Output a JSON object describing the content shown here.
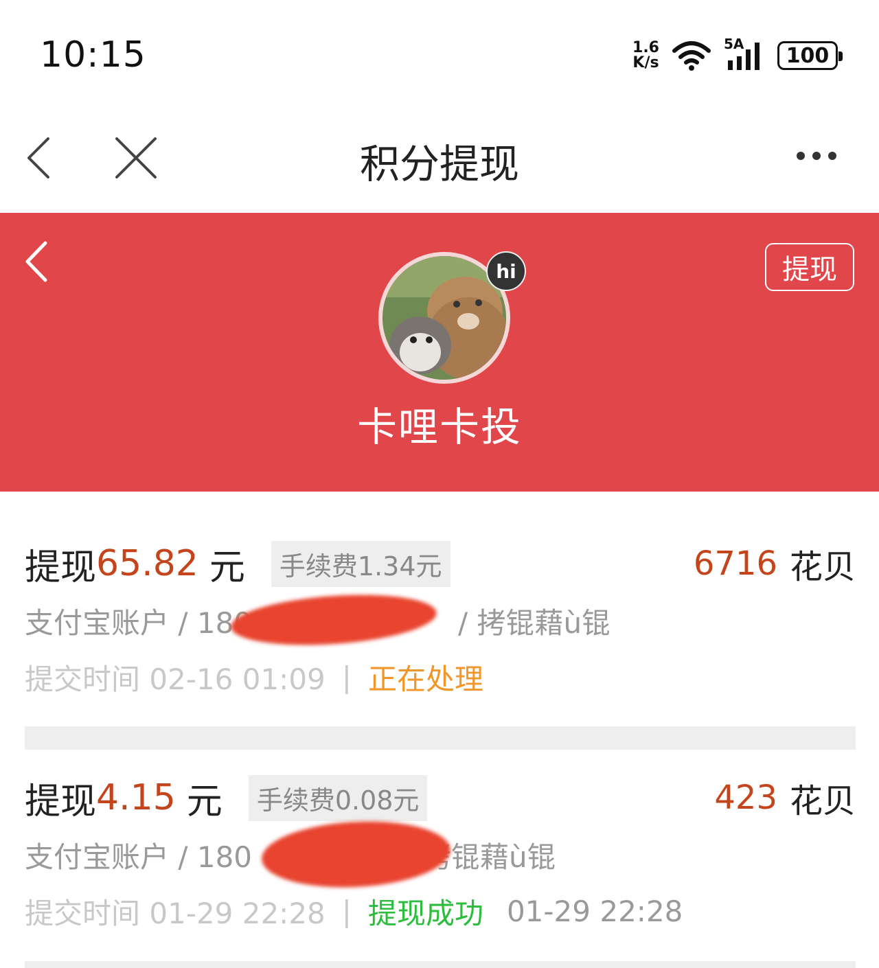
{
  "status_bar": {
    "time": "10:15",
    "net_speed_value": "1.6",
    "net_speed_unit": "K/s",
    "signal_label": "5A",
    "battery": "100"
  },
  "nav": {
    "title": "积分提现"
  },
  "header": {
    "withdraw_label": "提现",
    "badge": "hi",
    "user_name": "卡哩卡投"
  },
  "records": [
    {
      "prefix": "提现",
      "amount": "65.82",
      "unit": "元",
      "fee": "手续费1.34元",
      "points_value": "6716",
      "points_unit": "花贝",
      "account_prefix": "支付宝账户 / 180",
      "account_suffix": "/ 拷锟藉ù锟",
      "submit_label": "提交时间 02-16 01:09",
      "status": "正在处理",
      "status_color": "#f0962a"
    },
    {
      "prefix": "提现",
      "amount": "4.15",
      "unit": "元",
      "fee": "手续费0.08元",
      "points_value": "423",
      "points_unit": "花贝",
      "account_prefix": "支付宝账户 / 180",
      "account_suffix": "拷锟藉ù锟",
      "submit_label": "提交时间 01-29 22:28",
      "status": "提现成功",
      "status_color": "#2dbd3c",
      "done_time": "01-29 22:28"
    }
  ],
  "colors": {
    "header_red": "#e1464a",
    "amount_red": "#c4441c"
  }
}
